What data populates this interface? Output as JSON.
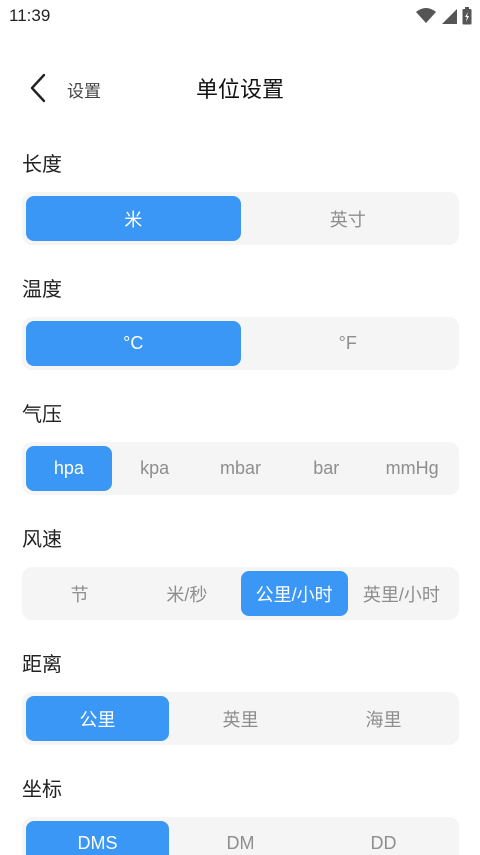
{
  "status": {
    "time": "11:39"
  },
  "nav": {
    "back_label": "设置",
    "title": "单位设置"
  },
  "sections": [
    {
      "title": "长度",
      "options": [
        "米",
        "英寸"
      ],
      "selected": 0
    },
    {
      "title": "温度",
      "options": [
        "°C",
        "°F"
      ],
      "selected": 0
    },
    {
      "title": "气压",
      "options": [
        "hpa",
        "kpa",
        "mbar",
        "bar",
        "mmHg"
      ],
      "selected": 0
    },
    {
      "title": "风速",
      "options": [
        "节",
        "米/秒",
        "公里/小时",
        "英里/小时"
      ],
      "selected": 2
    },
    {
      "title": "距离",
      "options": [
        "公里",
        "英里",
        "海里"
      ],
      "selected": 0
    },
    {
      "title": "坐标",
      "options": [
        "DMS",
        "DM",
        "DD"
      ],
      "selected": 0
    }
  ],
  "colors": {
    "accent": "#3a97f5",
    "segment_bg": "#f5f5f5",
    "inactive_text": "#8e8e8e"
  }
}
